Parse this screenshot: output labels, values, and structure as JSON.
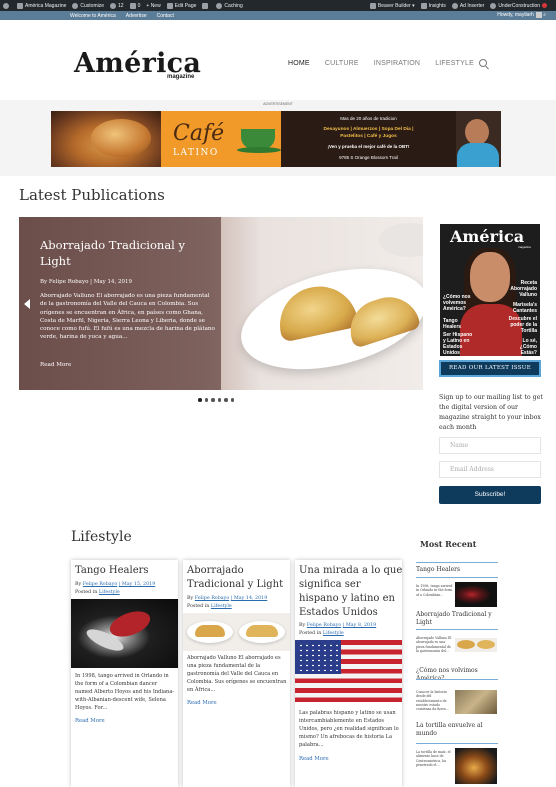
{
  "admin_bar": {
    "site_name": "América Magazine",
    "customize": "Customize",
    "updates": "12",
    "comments": "0",
    "new": "New",
    "edit_page": "Edit Page",
    "caching": "Caching",
    "beaver_builder": "Beaver Builder",
    "insights": "Insights",
    "ad_inserter": "Ad Inserter",
    "under_construction": "UnderConstruction"
  },
  "top_strip": {
    "links": [
      "Welcome to América",
      "Advertise",
      "Contact"
    ],
    "howdy": "Howdy, mayilarh"
  },
  "header": {
    "logo": "América",
    "logo_sub": "magazine",
    "nav": [
      "HOME",
      "CULTURE",
      "INSPIRATION",
      "LIFESTYLE"
    ]
  },
  "ad": {
    "label": "ADVERTISEMENT",
    "brand": "Café",
    "brand_sub": "LATINO",
    "line1": "Mas de 20 años de tradicion",
    "line2a": "Desayunos | Almuerzos | Sopa Del Dia |",
    "line2b": "Pastelitos | Café y Jugos",
    "line3": "¡Ven y prueba el mejor café de la OBT!",
    "line4": "9785 S Orange Blossom Trail"
  },
  "latest": {
    "title": "Latest Publications",
    "slide": {
      "title": "Aborrajado Tradicional y Light",
      "meta": "By Felipe Robayo | May 14, 2019",
      "excerpt": "Aborrajado Valluno El aborrajado es una pieza fundamental de la gastronomía del Valle del Cauca en Colombia. Sus orígenes se encuentran en África, en países como Ghana, Costa de Marfil, Nigeria, Sierra Leona y Liberia, donde se conoce como fufú. El fufú es una mezcla de harina de plátano verde, harina de yuca y agua...",
      "read_more": "Read More"
    },
    "dots_count": 6
  },
  "sidebar": {
    "magazine_title": "América",
    "magazine_sub": "magazine",
    "cover_left": [
      "¿Cómo nos volvemos América?",
      "Tango Healers",
      "Ser Hispano y Latino en Estados Unidos"
    ],
    "cover_right": [
      "Receta Aborrajado Valluno",
      "Marisela's Cantantes",
      "Descubre el poder de la Tortilla",
      "Lo sé, ¿Cómo Estás?"
    ],
    "read_issue": "READ OUR LATEST ISSUE",
    "signup": "Sign up to our mailing list to get the digital version of our magazine straight to your inbox each month",
    "name_placeholder": "Name",
    "email_placeholder": "Email Address",
    "subscribe": "Subscribe!"
  },
  "lifestyle": {
    "title": "Lifestyle",
    "cards": [
      {
        "title": "Tango Healers",
        "by": "By",
        "author": "Felipe Robayo",
        "date": "| May 15, 2019",
        "posted": "Posted in",
        "category": "Lifestyle",
        "excerpt": "In 1998, tango arrived in Orlando in the form of a Colombian dancer named Alberto Hoyos and his Indiana-with-Albanian-descent wife, Selena Hoyos. For...",
        "read_more": "Read More"
      },
      {
        "title": "Aborrajado Tradicional y Light",
        "by": "By",
        "author": "Felipe Robayo",
        "date": "| May 14, 2019",
        "posted": "Posted in",
        "category": "Lifestyle",
        "excerpt": "Aborrajado Valluno El aborrajado es una pieza fundamental de la gastronomía del Valle del Cauca en Colombia. Sus orígenes se encuentran en África...",
        "read_more": "Read More"
      },
      {
        "title": "Una mirada a lo que significa ser hispano y latino en Estados Unidos",
        "by": "By",
        "author": "Felipe Robayo",
        "date": "| May 8, 2019",
        "posted": "Posted in",
        "category": "Lifestyle",
        "excerpt": "Las palabras hispano y latino se usan intercambiablemente en Estados Unidos, pero ¿en realidad significan lo mismo? Un afrebocas de historia La palabra...",
        "read_more": "Read More"
      }
    ]
  },
  "most_recent": {
    "title": "Most Recent",
    "items": [
      {
        "title": "Tango Healers",
        "excerpt": "In 1998, tango arrived in Orlando in the form of a Colombian..."
      },
      {
        "title": "Aborrajado Tradicional y Light",
        "excerpt": "Aborrajado Valluno El aborrajado es una pieza fundamental de la gastronomía del..."
      },
      {
        "title": "¿Cómo nos volvimos América?",
        "excerpt": "Conocer la historia desde del establecimiento de nuestro estado comienza da fuera..."
      },
      {
        "title": "La tortilla envuelve al mundo",
        "excerpt": "La tortilla de maíz, el alimento base de Centroamérica, ha penetrado el..."
      }
    ]
  }
}
